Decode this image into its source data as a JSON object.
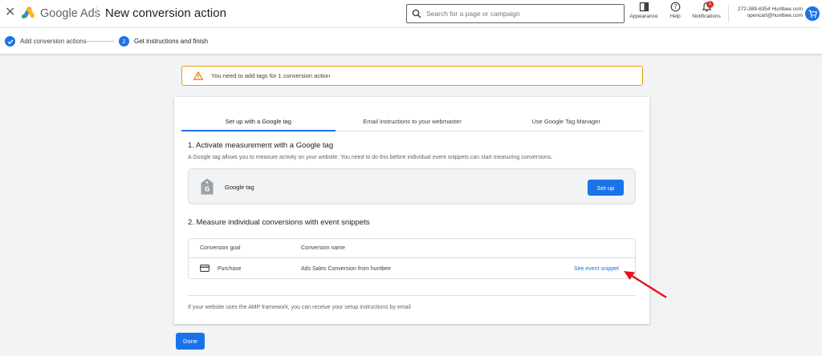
{
  "header": {
    "app_name": "Google Ads",
    "page_title": "New conversion action",
    "search_placeholder": "Search for a page or campaign",
    "appearance_label": "Appearance",
    "help_label": "Help",
    "notifications_label": "Notifications",
    "notifications_count": "1",
    "account_line1": "272-389-6354 Huntbee.com",
    "account_line2": "opencart@huntbee.com"
  },
  "stepper": {
    "steps": [
      {
        "label": "Add conversion actions",
        "state": "done"
      },
      {
        "label": "Get instructions and finish",
        "number": "2",
        "state": "current"
      }
    ]
  },
  "alert": {
    "text": "You need to add tags for 1 conversion action"
  },
  "tabs": [
    {
      "label": "Set up with a Google tag",
      "active": true
    },
    {
      "label": "Email instructions to your webmaster",
      "active": false
    },
    {
      "label": "Use Google Tag Manager",
      "active": false
    }
  ],
  "section1": {
    "title": "1. Activate measurement with a Google tag",
    "description": "A Google tag allows you to measure activity on your website. You need to do this before individual event snippets can start measuring conversions.",
    "tag_label": "Google tag",
    "setup_button": "Set up"
  },
  "section2": {
    "title": "2. Measure individual conversions with event snippets",
    "columns": [
      "Conversion goal",
      "Conversion name"
    ],
    "rows": [
      {
        "goal": "Purchase",
        "name": "Ads Sales Conversion from huntbee",
        "action": "See event snippet"
      }
    ]
  },
  "amp_text": "If your website uses the AMP framework, you can receive your setup instructions by email",
  "done_button": "Done",
  "colors": {
    "primary": "#1a73e8",
    "warning": "#f29900",
    "annotation_arrow": "#e8101a",
    "background": "#f1f3f4"
  }
}
